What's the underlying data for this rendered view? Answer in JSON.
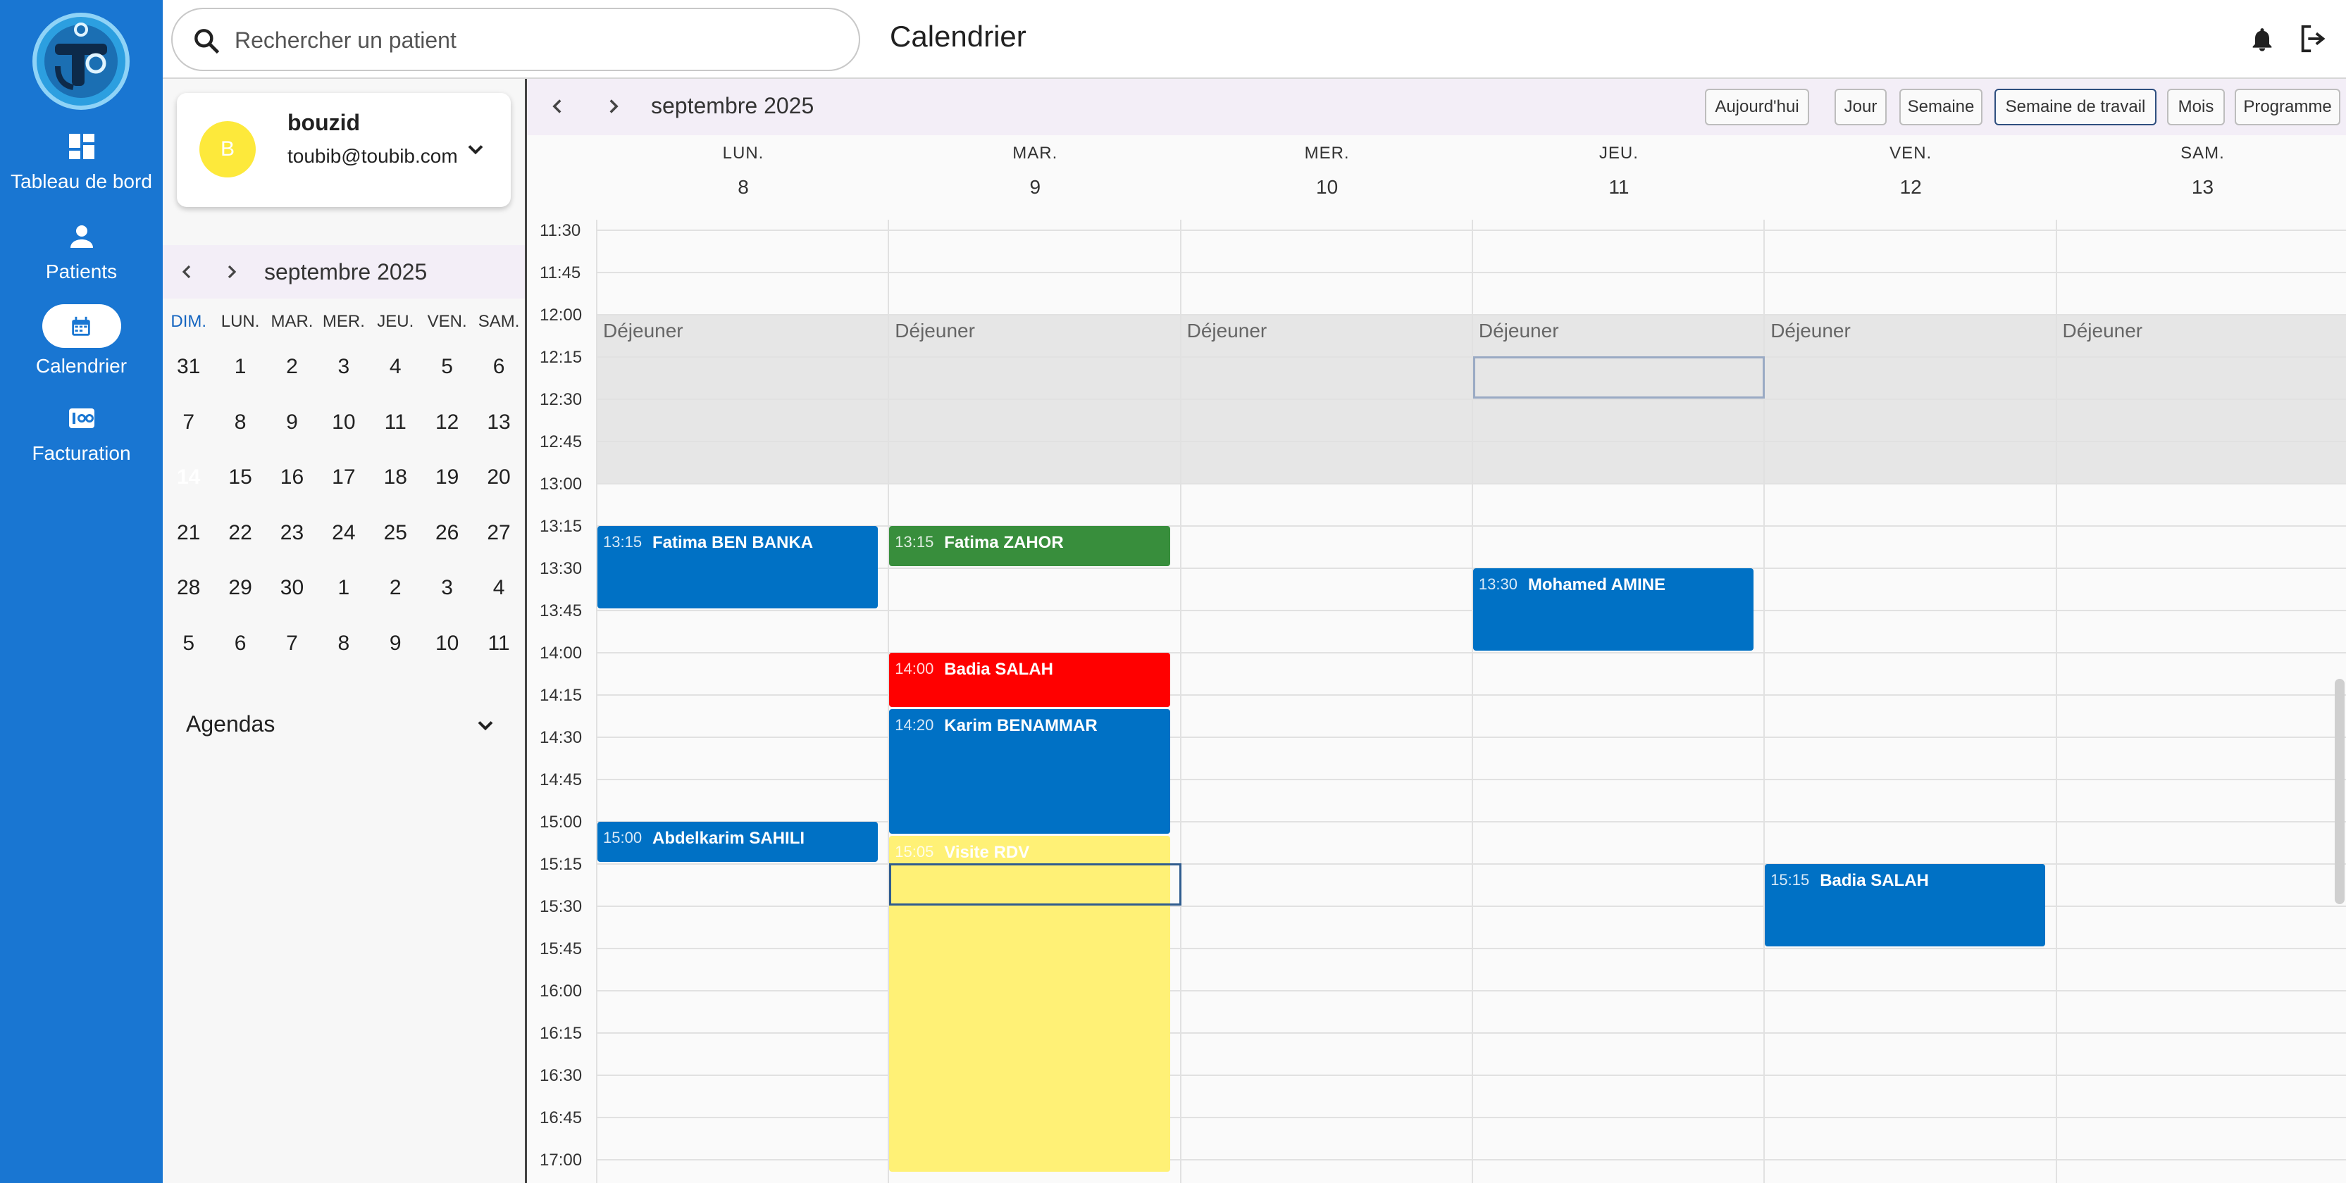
{
  "nav": {
    "items": [
      {
        "label": "Tableau de bord",
        "icon": "dashboard-icon"
      },
      {
        "label": "Patients",
        "icon": "person-icon"
      },
      {
        "label": "Calendrier",
        "icon": "calendar-icon",
        "active": true
      },
      {
        "label": "Facturation",
        "icon": "billing-icon"
      }
    ]
  },
  "search": {
    "placeholder": "Rechercher un patient"
  },
  "header": {
    "title": "Calendrier"
  },
  "user": {
    "initial": "B",
    "name": "bouzid",
    "email": "toubib@toubib.com"
  },
  "mini_calendar": {
    "month": "septembre 2025",
    "dow": [
      "DIM.",
      "LUN.",
      "MAR.",
      "MER.",
      "JEU.",
      "VEN.",
      "SAM."
    ],
    "weeks": [
      [
        "31",
        "1",
        "2",
        "3",
        "4",
        "5",
        "6"
      ],
      [
        "7",
        "8",
        "9",
        "10",
        "11",
        "12",
        "13"
      ],
      [
        "14",
        "15",
        "16",
        "17",
        "18",
        "19",
        "20"
      ],
      [
        "21",
        "22",
        "23",
        "24",
        "25",
        "26",
        "27"
      ],
      [
        "28",
        "29",
        "30",
        "1",
        "2",
        "3",
        "4"
      ],
      [
        "5",
        "6",
        "7",
        "8",
        "9",
        "10",
        "11"
      ]
    ],
    "today": "14"
  },
  "agendas": {
    "label": "Agendas"
  },
  "calendar": {
    "month": "septembre 2025",
    "buttons": {
      "today": "Aujourd'hui",
      "day": "Jour",
      "week": "Semaine",
      "workweek": "Semaine de travail",
      "month": "Mois",
      "schedule": "Programme"
    },
    "active_view": "workweek",
    "days": [
      {
        "dow": "LUN.",
        "num": "8"
      },
      {
        "dow": "MAR.",
        "num": "9"
      },
      {
        "dow": "MER.",
        "num": "10"
      },
      {
        "dow": "JEU.",
        "num": "11"
      },
      {
        "dow": "VEN.",
        "num": "12"
      },
      {
        "dow": "SAM.",
        "num": "13"
      }
    ],
    "times": [
      "11:30",
      "11:45",
      "12:00",
      "12:15",
      "12:30",
      "12:45",
      "13:00",
      "13:15",
      "13:30",
      "13:45",
      "14:00",
      "14:15",
      "14:30",
      "14:45",
      "15:00",
      "15:15",
      "15:30",
      "15:45",
      "16:00",
      "16:15",
      "16:30",
      "16:45",
      "17:00"
    ],
    "lunch_label": "Déjeuner",
    "events": [
      {
        "day": 0,
        "time": "13:15",
        "name": "Fatima BEN BANKA",
        "start": "13:15",
        "end": "13:45",
        "color": "#0071c5"
      },
      {
        "day": 1,
        "time": "13:15",
        "name": "Fatima ZAHOR",
        "start": "13:15",
        "end": "13:30",
        "color": "#388e3c"
      },
      {
        "day": 3,
        "time": "13:30",
        "name": "Mohamed AMINE",
        "start": "13:30",
        "end": "14:00",
        "color": "#0071c5"
      },
      {
        "day": 1,
        "time": "14:00",
        "name": "Badia SALAH",
        "start": "14:00",
        "end": "14:20",
        "color": "#ff0000"
      },
      {
        "day": 1,
        "time": "14:20",
        "name": "Karim BENAMMAR",
        "start": "14:20",
        "end": "15:05",
        "color": "#0071c5"
      },
      {
        "day": 0,
        "time": "15:00",
        "name": "Abdelkarim SAHILI",
        "start": "15:00",
        "end": "15:15",
        "color": "#0071c5"
      },
      {
        "day": 1,
        "time": "15:05",
        "name": "Visite RDV",
        "start": "15:05",
        "end": "17:05",
        "color": "#fff176"
      },
      {
        "day": 4,
        "time": "15:15",
        "name": "Badia SALAH",
        "start": "15:15",
        "end": "15:45",
        "color": "#0071c5"
      }
    ]
  }
}
